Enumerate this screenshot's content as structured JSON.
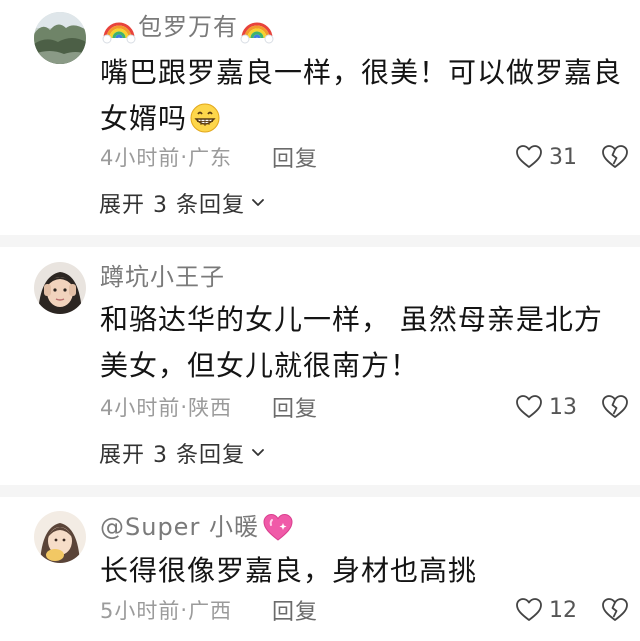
{
  "comments": [
    {
      "username": "包罗万有",
      "username_emoji": "rainbow",
      "text": "嘴巴跟罗嘉良一样，很美！可以做罗嘉良女婿吗",
      "text_emoji": "grinning-face",
      "time": "4小时前",
      "location": "广东",
      "reply_label": "回复",
      "likes": "31",
      "expand_label": "展开 3 条回复"
    },
    {
      "username": "蹲坑小王子",
      "text": "和骆达华的女儿一样， 虽然母亲是北方美女，但女儿就很南方！",
      "time": "4小时前",
      "location": "陕西",
      "reply_label": "回复",
      "likes": "13",
      "expand_label": "展开 3 条回复"
    },
    {
      "username": "@Super 小暖",
      "username_emoji": "sparkling-heart",
      "text": "长得很像罗嘉良，身材也高挑",
      "time": "5小时前",
      "location": "广西",
      "reply_label": "回复",
      "likes": "12"
    }
  ],
  "separator": " · ",
  "colors": {
    "username": "#7a7a7a",
    "meta": "#9b9b9b",
    "divider": "#f5f5f5"
  }
}
